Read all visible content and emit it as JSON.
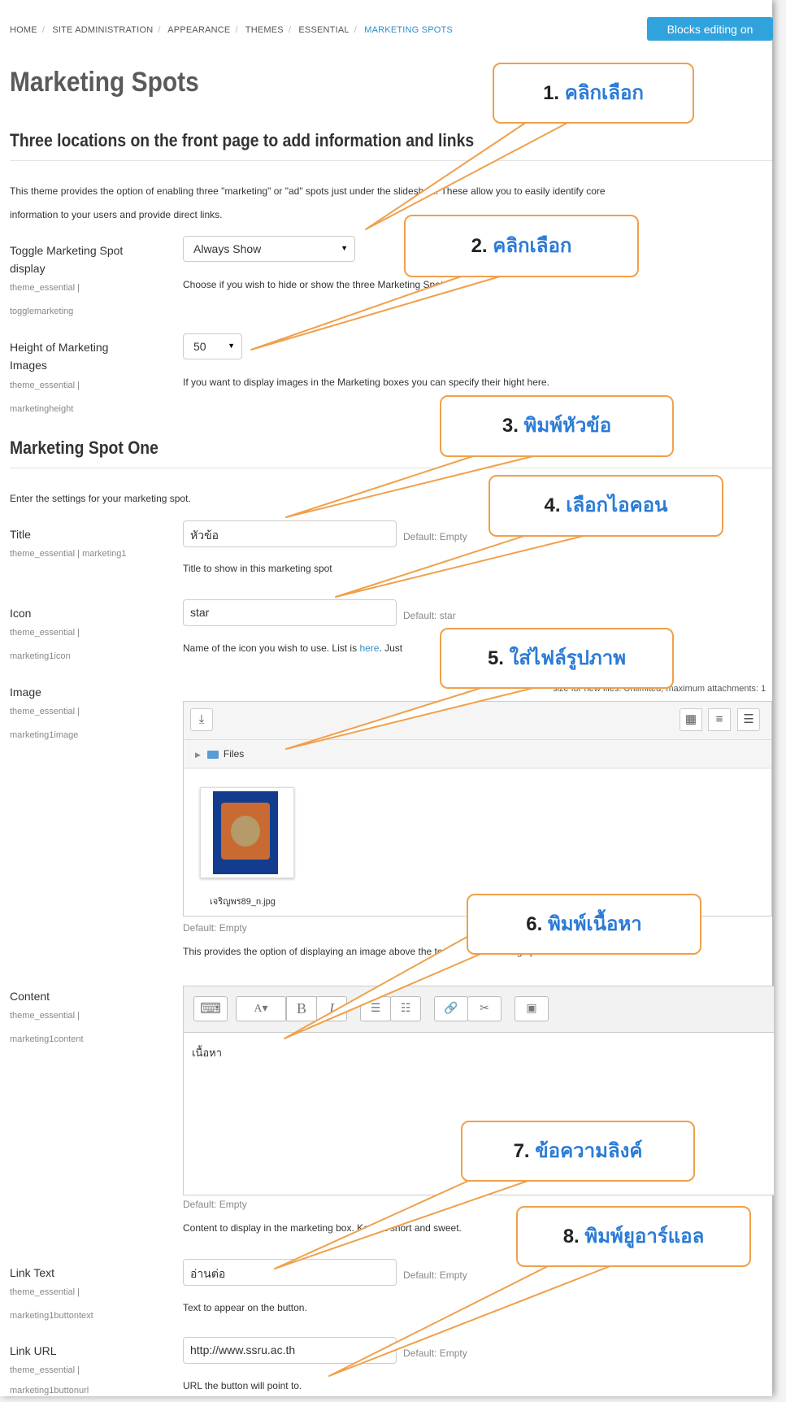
{
  "breadcrumb": [
    "HOME",
    "SITE ADMINISTRATION",
    "APPEARANCE",
    "THEMES",
    "ESSENTIAL",
    "MARKETING SPOTS"
  ],
  "blocks_button": "Blocks editing on",
  "page_title": "Marketing Spots",
  "section1": {
    "heading": "Three locations on the front page to add information and links",
    "desc_line1": "This theme provides the option of enabling three \"marketing\" or \"ad\" spots just under the slideshow. These allow you to easily identify core",
    "desc_line2": "information to your users and provide direct links."
  },
  "toggle": {
    "label": "Toggle Marketing Spot display",
    "sub1": "theme_essential |",
    "sub2": "togglemarketing",
    "value": "Always Show",
    "help": "Choose if you wish to hide or show the three Marketing Spots."
  },
  "height": {
    "label": "Height of Marketing Images",
    "sub1": "theme_essential |",
    "sub2": "marketingheight",
    "value": "50",
    "help": "If you want to display images in the Marketing boxes you can specify their hight here."
  },
  "section2": {
    "heading": "Marketing Spot One",
    "desc": "Enter the settings for your marketing spot."
  },
  "title_field": {
    "label": "Title",
    "sub1": "theme_essential | marketing1",
    "value": "หัวข้อ",
    "default": "Default: Empty",
    "help": "Title to show in this marketing spot"
  },
  "icon_field": {
    "label": "Icon",
    "sub1": "theme_essential |",
    "sub2": "marketing1icon",
    "value": "star",
    "default": "Default: star",
    "help_pre": "Name of the icon you wish to use. List is ",
    "help_link": "here",
    "help_post": ". Just"
  },
  "image_field": {
    "label": "Image",
    "sub1": "theme_essential |",
    "sub2": "marketing1image",
    "limits": "size for new files: Unlimited, maximum attachments: 1",
    "folder": "Files",
    "filename": "เจริญพร89_n.jpg",
    "default": "Default: Empty",
    "help": "This provides the option of displaying an image above the text in the marketing spot"
  },
  "content_field": {
    "label": "Content",
    "sub1": "theme_essential |",
    "sub2": "marketing1content",
    "value": "เนื้อหา",
    "default": "Default: Empty",
    "help": "Content to display in the marketing box. Keep it short and sweet."
  },
  "linktext_field": {
    "label": "Link Text",
    "sub1": "theme_essential |",
    "sub2": "marketing1buttontext",
    "value": "อ่านต่อ",
    "default": "Default: Empty",
    "help": "Text to appear on the button."
  },
  "linkurl_field": {
    "label": "Link URL",
    "sub1": "theme_essential |",
    "sub2": "marketing1buttonurl",
    "value": "http://www.ssru.ac.th",
    "default": "Default: Empty",
    "help": "URL the button will point to."
  },
  "callouts": [
    {
      "num": "1.",
      "text": "คลิกเลือก"
    },
    {
      "num": "2.",
      "text": "คลิกเลือก"
    },
    {
      "num": "3.",
      "text": "พิมพ์หัวข้อ"
    },
    {
      "num": "4.",
      "text": "เลือกไอคอน"
    },
    {
      "num": "5.",
      "text": "ใส่ไฟล์รูปภาพ"
    },
    {
      "num": "6.",
      "text": "พิมพ์เนื้อหา"
    },
    {
      "num": "7.",
      "text": "ข้อความลิงค์"
    },
    {
      "num": "8.",
      "text": "พิมพ์ยูอาร์แอล"
    }
  ],
  "colors": {
    "accent": "#30a3dd",
    "callout_border": "#f0a04b",
    "callout_text": "#2b7bd6"
  }
}
